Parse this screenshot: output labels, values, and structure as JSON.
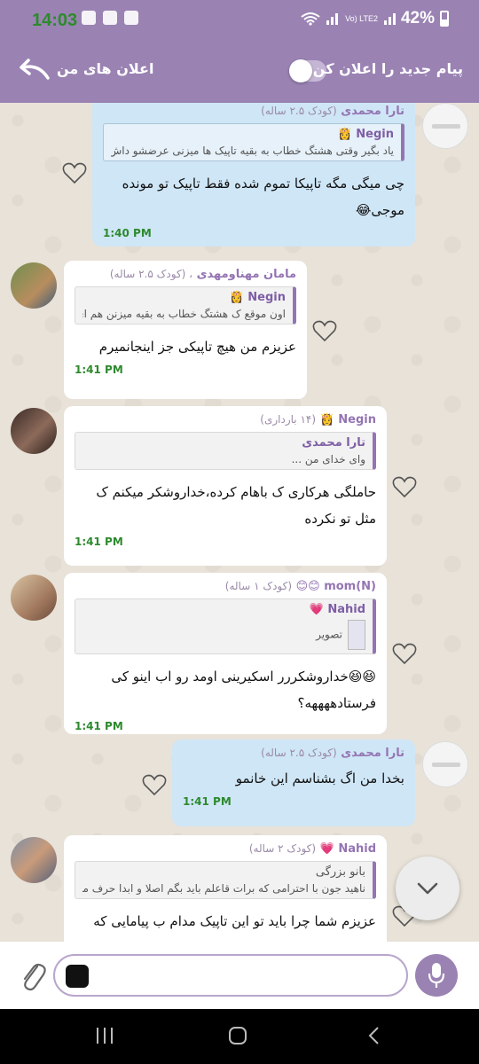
{
  "status": {
    "time": "14:03",
    "network": "Vo) LTE2",
    "battery": "42%"
  },
  "header": {
    "title": "اعلان های من",
    "notify_label": "پیام جدید را اعلان کن",
    "toggle_on": false
  },
  "colors": {
    "header": "#9a83b3",
    "out_bubble": "#cfe6f6",
    "in_bubble": "#ffffff",
    "time": "#2d8a2d",
    "accent": "#9474b3"
  },
  "messages": [
    {
      "direction": "out",
      "sender": "تارا محمدی",
      "meta": "(کودک ۲.۵ ساله)",
      "quote_name": "Negin 👸",
      "quote_text": "یاد بگیر وقتی هشتگ خطاب به بقیه تاپیک ها میزنی عرضشو داش...",
      "text": "چی میگی مگه تاپیکا تموم شده فقط تاپیک تو مونده موجی😂",
      "time": "1:40 PM"
    },
    {
      "direction": "in",
      "sender": "مامان مهناومهدی",
      "meta": "، (کودک ۲.۵ ساله)",
      "quote_name": "Negin 👸",
      "quote_text": "اون موقع ک هشتگ خطاب به بقیه میزنن هم ای.",
      "text": "عزیزم من هیچ تاپیکی جز اینجانمیرم",
      "time": "1:41 PM"
    },
    {
      "direction": "in",
      "sender": "Negin 👸",
      "meta": "(۱۴ بارداری)",
      "quote_name": "تارا محمدی",
      "quote_text": "وای خدای من ...",
      "text": "حاملگی هرکاری ک باهام کرده،خداروشکر میکنم ک مثل تو نکرده",
      "time": "1:41 PM"
    },
    {
      "direction": "in",
      "sender": "mom(N) 😊😊",
      "meta": "(کودک ۱ ساله)",
      "quote_name": "Nahid 💗",
      "quote_text": "تصویر",
      "text": "😆😆خداروشکررر اسکیرینی اومد رو اب اینو کی فرستادههههه؟",
      "time": "1:41 PM"
    },
    {
      "direction": "out",
      "sender": "تارا محمدی",
      "meta": "(کودک ۲.۵ ساله)",
      "text": "بخدا من اگ بشناسم این خانمو",
      "time": "1:41 PM"
    },
    {
      "direction": "in",
      "sender": "Nahid 💗",
      "meta": "(کودک ۲ ساله)",
      "quote_name": "بانو بزرگی",
      "quote_text": "ناهید جون با احترامی که برات قاعلم باید بگم اصلا و ابدا حرف من...",
      "text": "عزیزم شما چرا باید تو این تاپیک مدام ب پیامایی که"
    }
  ],
  "input": {
    "placeholder": "",
    "value": ""
  },
  "icons": {
    "back": "back-arrow-icon",
    "attach": "paperclip-icon",
    "mic": "microphone-icon",
    "sticker": "sticker-icon",
    "scroll": "chevron-down-icon",
    "heart": "heart-icon"
  }
}
